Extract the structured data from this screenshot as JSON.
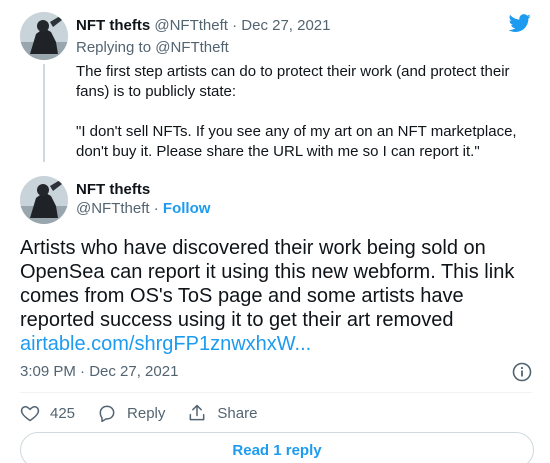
{
  "brand": {
    "icon": "twitter-bird-icon",
    "color": "#1d9bf0"
  },
  "parent_tweet": {
    "display_name": "NFT thefts",
    "handle": "@NFTtheft",
    "separator": "·",
    "date": "Dec 27, 2021",
    "replying_prefix": "Replying to",
    "replying_handle": "@NFTtheft",
    "text_paragraph_1": "The first step artists can do to protect their work (and protect their fans) is to publicly state:",
    "text_paragraph_2": "\"I don't sell NFTs. If you see any of my art on an NFT marketplace, don't buy it. Please share the URL with me so I can report it.\""
  },
  "main_tweet": {
    "display_name": "NFT thefts",
    "handle": "@NFTtheft",
    "separator": "·",
    "follow_label": "Follow",
    "text": "Artists who have discovered their work being sold on OpenSea can report it using this new webform. This link comes from OS's ToS page and some artists have reported success using it to get their art removed",
    "link_text": "airtable.com/shrgFP1znwxhxW...",
    "timestamp": "3:09 PM · Dec 27, 2021"
  },
  "actions": {
    "like_count": "425",
    "reply_label": "Reply",
    "share_label": "Share"
  },
  "read_reply_label": "Read 1 reply",
  "colors": {
    "text_primary": "#0f1419",
    "text_secondary": "#536471",
    "accent": "#1d9bf0",
    "border": "#cfd9de"
  }
}
